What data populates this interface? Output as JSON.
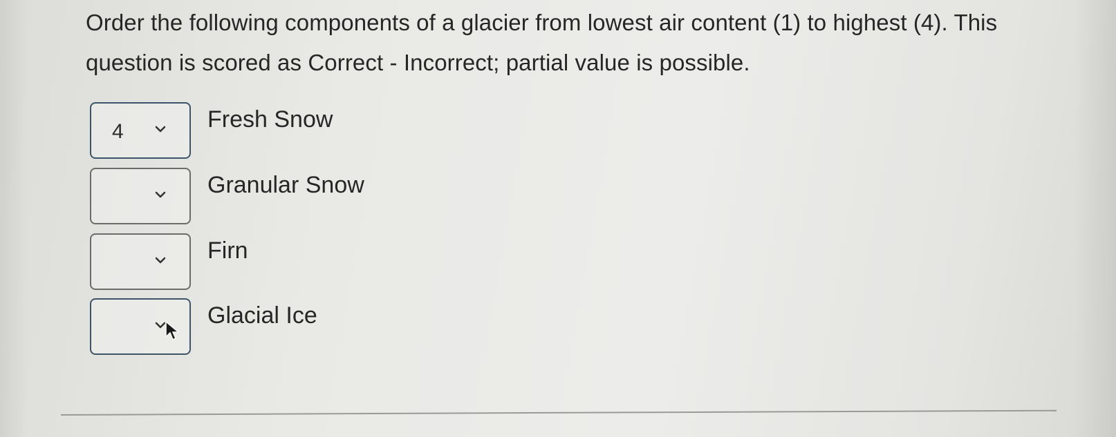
{
  "question": {
    "text": "Order the following components of a glacier from lowest air content (1) to highest (4). This question is scored as Correct - Incorrect; partial value is possible."
  },
  "items": [
    {
      "selected": "4",
      "label": "Fresh Snow"
    },
    {
      "selected": "",
      "label": "Granular Snow"
    },
    {
      "selected": "",
      "label": "Firn"
    },
    {
      "selected": "",
      "label": "Glacial Ice"
    }
  ],
  "icons": {
    "dropdown": "chevron-down-icon",
    "cursor": "mouse-pointer-icon"
  },
  "colors": {
    "focus_border": "#3c5468",
    "default_border": "#6b6b6b",
    "text": "#262626"
  }
}
